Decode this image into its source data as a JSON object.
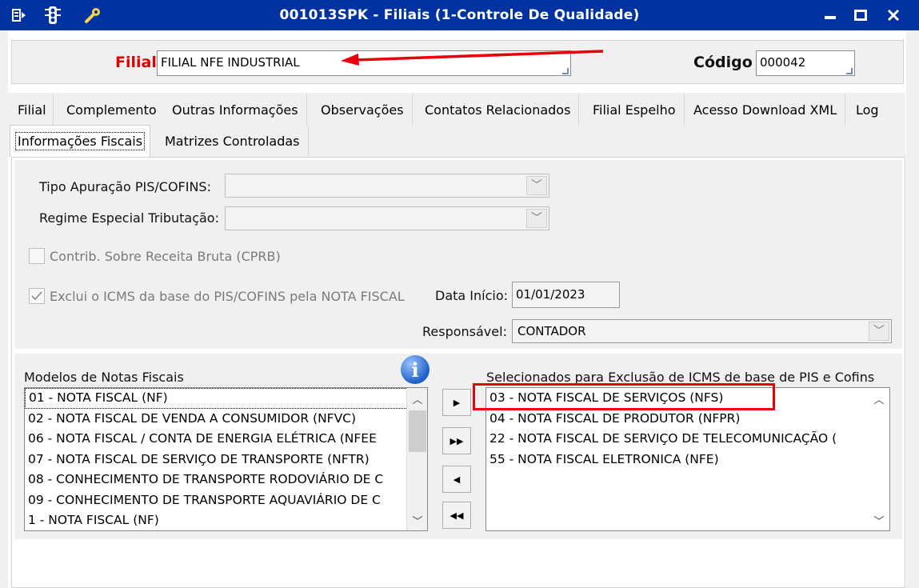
{
  "window": {
    "title": "001013SPK - Filiais (1-Controle De Qualidade)",
    "controls": {
      "minimize": "—",
      "maximize": "■",
      "close": "✕"
    }
  },
  "header": {
    "filial_label": "Filial",
    "filial_value": "FILIAL NFE INDUSTRIAL",
    "codigo_label": "Código",
    "codigo_value": "000042"
  },
  "tabs": {
    "row1": [
      "Filial",
      "Complemento",
      "Outras Informações",
      "Observações",
      "Contatos Relacionados",
      "Filial Espelho",
      "Acesso Download XML",
      "Log"
    ],
    "row2": [
      "Informações Fiscais",
      "Matrizes Controladas"
    ],
    "active": "Informações Fiscais"
  },
  "form": {
    "tipo_apuracao_label": "Tipo Apuração PIS/COFINS:",
    "tipo_apuracao_value": "",
    "regime_label": "Regime Especial Tributação:",
    "regime_value": "",
    "cprb_label": "Contrib. Sobre Receita Bruta (CPRB)",
    "cprb_checked": false,
    "exclui_label": "Exclui o ICMS da base do PIS/COFINS pela NOTA FISCAL",
    "exclui_checked": true,
    "data_inicio_label": "Data Início:",
    "data_inicio_value": "01/01/2023",
    "responsavel_label": "Responsável:",
    "responsavel_value": "CONTADOR"
  },
  "modelos": {
    "label": "Modelos de Notas Fiscais",
    "items": [
      "01  - NOTA FISCAL (NF)",
      "02  - NOTA FISCAL DE VENDA A CONSUMIDOR (NFVC)",
      "06  - NOTA FISCAL / CONTA DE ENERGIA ELÉTRICA (NFEE",
      "07  - NOTA FISCAL DE SERVIÇO DE TRANSPORTE (NFTR)",
      "08  - CONHECIMENTO DE TRANSPORTE RODOVIÁRIO DE C",
      "09  - CONHECIMENTO DE TRANSPORTE AQUAVIÁRIO DE C",
      "1   - NOTA FISCAL (NF)"
    ]
  },
  "selecionados": {
    "label": "Selecionados para Exclusão de ICMS de base de PIS e Cofins",
    "items": [
      "03  - NOTA FISCAL DE SERVIÇOS (NFS)",
      "04  - NOTA FISCAL DE PRODUTOR (NFPR)",
      "22  - NOTA FISCAL DE SERVIÇO DE TELECOMUNICAÇÃO (",
      "55  - NOTA FISCAL ELETRONICA (NFE)"
    ]
  },
  "move_buttons": {
    "add": "▶",
    "add_all": "▶▶",
    "remove": "◀",
    "remove_all": "◀◀"
  },
  "colors": {
    "titlebar": "#0033a0",
    "label_red": "#e00000",
    "annotation_red": "#e8000b"
  },
  "icons": {
    "titlebar_menu": "menu-icon",
    "titlebar_traffic": "traffic-light-icon",
    "titlebar_tools": "tools-icon",
    "info": "info-icon"
  }
}
